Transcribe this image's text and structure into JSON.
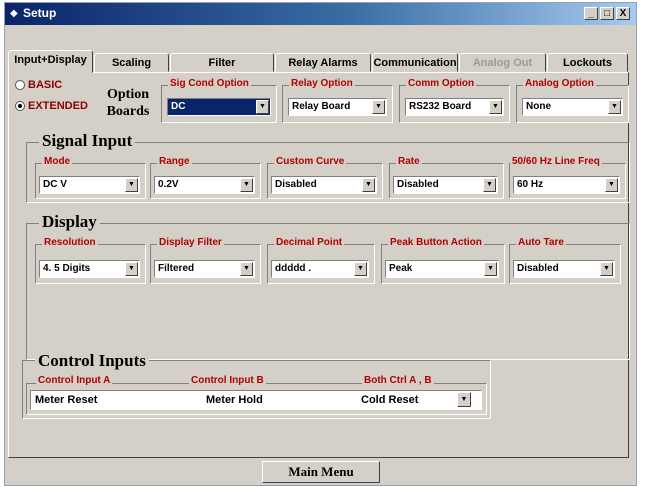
{
  "window": {
    "title": "Setup",
    "min": "_",
    "max": "□",
    "close": "X"
  },
  "tabs": [
    {
      "label": "Input+Display",
      "active": true,
      "disabled": false
    },
    {
      "label": "Scaling",
      "active": false,
      "disabled": false
    },
    {
      "label": "Filter",
      "active": false,
      "disabled": false
    },
    {
      "label": "Relay Alarms",
      "active": false,
      "disabled": false
    },
    {
      "label": "Communication",
      "active": false,
      "disabled": false
    },
    {
      "label": "Analog Out",
      "active": false,
      "disabled": true
    },
    {
      "label": "Lockouts",
      "active": false,
      "disabled": false
    }
  ],
  "mode": {
    "basic_label": "BASIC",
    "extended_label": "EXTENDED",
    "selected": "EXTENDED"
  },
  "option_boards": {
    "label_line1": "Option",
    "label_line2": "Boards",
    "sig_cond": {
      "label": "Sig Cond Option",
      "value": "DC"
    },
    "relay": {
      "label": "Relay Option",
      "value": "Relay Board"
    },
    "comm": {
      "label": "Comm Option",
      "value": "RS232 Board"
    },
    "analog": {
      "label": "Analog Option",
      "value": "None"
    }
  },
  "signal_input": {
    "title": "Signal Input",
    "mode": {
      "label": "Mode",
      "value": "DC V"
    },
    "range": {
      "label": "Range",
      "value": "0.2V"
    },
    "custom_curve": {
      "label": "Custom Curve",
      "value": "Disabled"
    },
    "rate": {
      "label": "Rate",
      "value": "Disabled"
    },
    "line_freq": {
      "label": "50/60 Hz Line Freq",
      "value": "60 Hz"
    }
  },
  "display": {
    "title": "Display",
    "resolution": {
      "label": "Resolution",
      "value": "4. 5 Digits"
    },
    "display_filter": {
      "label": "Display Filter",
      "value": "Filtered"
    },
    "decimal_point": {
      "label": "Decimal Point",
      "value": "ddddd ."
    },
    "peak_button": {
      "label": "Peak Button Action",
      "value": "Peak"
    },
    "auto_tare": {
      "label": "Auto Tare",
      "value": "Disabled"
    }
  },
  "control_inputs": {
    "title": "Control Inputs",
    "a_label": "Control Input A",
    "b_label": "Control Input B",
    "both_label": "Both Ctrl A , B",
    "a_value": "Meter Reset",
    "b_value": "Meter Hold",
    "both_value": "Cold Reset"
  },
  "footer": {
    "main_menu": "Main Menu"
  },
  "colors": {
    "title_bar": "#0a246a",
    "label_red": "#b00000",
    "window_bg": "#d4d0c8"
  }
}
